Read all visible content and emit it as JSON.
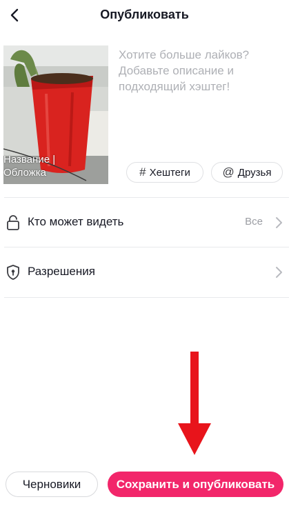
{
  "header": {
    "title": "Опубликовать"
  },
  "post": {
    "cover_label_line1": "Название |",
    "cover_label_line2": "Обложка",
    "description_placeholder": "Хотите больше лайков? Добавьте описание и подходящий хэштег!"
  },
  "chips": {
    "hashtags_label": "Хештеги",
    "hashtags_symbol": "#",
    "friends_label": "Друзья",
    "friends_symbol": "@"
  },
  "settings": {
    "visibility_label": "Кто может видеть",
    "visibility_value": "Все",
    "permissions_label": "Разрешения"
  },
  "footer": {
    "drafts_label": "Черновики",
    "publish_label": "Сохранить и опубликовать"
  },
  "colors": {
    "accent": "#f2266a",
    "annotation_arrow": "#e8141b"
  }
}
